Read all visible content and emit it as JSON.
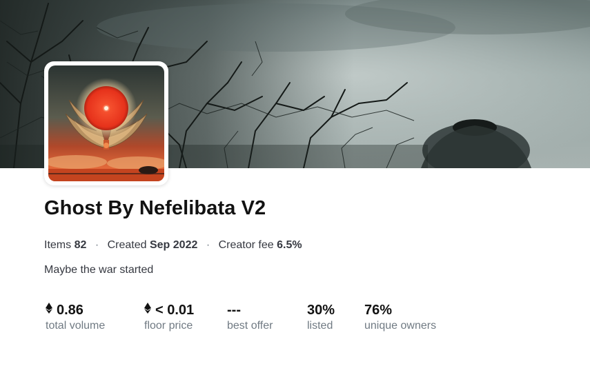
{
  "collection": {
    "title": "Ghost By Nefelibata V2",
    "description": "Maybe the war started",
    "banner_image": "misty-tree-branches-banner",
    "avatar_image": "red-sun-wings-artwork"
  },
  "meta": {
    "items_label": "Items",
    "items_value": "82",
    "created_label": "Created",
    "created_value": "Sep 2022",
    "fee_label": "Creator fee",
    "fee_value": "6.5%",
    "separator": "·"
  },
  "stats": [
    {
      "icon": "eth-icon",
      "value": "0.86",
      "label": "total volume"
    },
    {
      "icon": "eth-icon",
      "value": "< 0.01",
      "label": "floor price"
    },
    {
      "icon": "",
      "value": "---",
      "label": "best offer"
    },
    {
      "icon": "",
      "value": "30%",
      "label": "listed"
    },
    {
      "icon": "",
      "value": "76%",
      "label": "unique owners"
    }
  ],
  "colors": {
    "text_primary": "#121212",
    "text_secondary": "#353840",
    "text_muted": "#707a83"
  }
}
